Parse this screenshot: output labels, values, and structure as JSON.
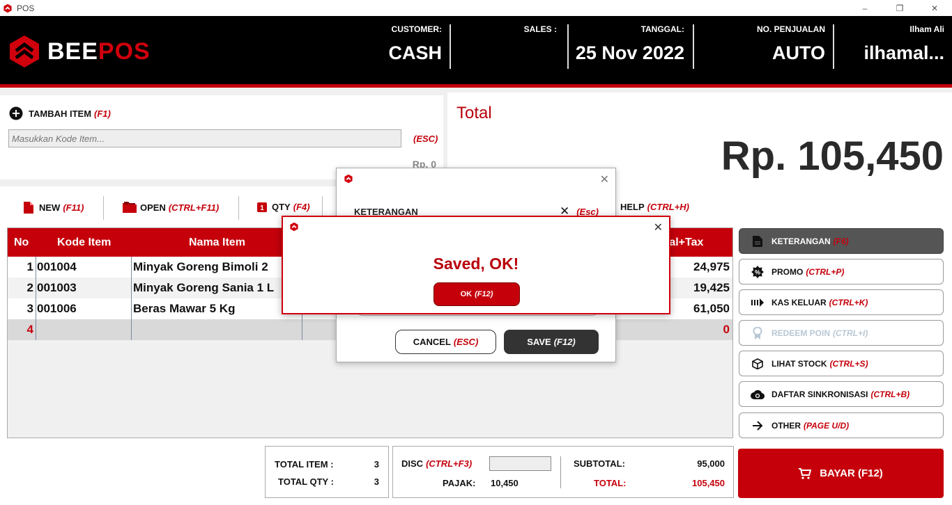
{
  "window": {
    "title": "POS",
    "minimize": "–",
    "restore": "❐",
    "close": "✕"
  },
  "brand": {
    "bee": "BEE",
    "pos": "POS"
  },
  "header": {
    "customer_label": "CUSTOMER:",
    "customer_value": "CASH",
    "sales_label": "SALES :",
    "sales_value": "",
    "date_label": "TANGGAL:",
    "date_value": "25 Nov 2022",
    "sale_no_label": "NO. PENJUALAN",
    "sale_no_value": "AUTO",
    "user_label": "Ilham Ali",
    "user_value": "ilhamal..."
  },
  "add_item": {
    "label": "TAMBAH ITEM",
    "key": "(F1)",
    "placeholder": "Masukkan Kode Item...",
    "esc": "(ESC)",
    "price": "Rp. 0"
  },
  "total": {
    "label": "Total",
    "value": "Rp. 105,450"
  },
  "toolbar": {
    "new_label": "NEW",
    "new_key": "(F11)",
    "open_label": "OPEN",
    "open_key": "(CTRL+F11)",
    "qty_label": "QTY",
    "qty_key": "(F4)",
    "help_label": "HELP",
    "help_key": "(CTRL+H)"
  },
  "grid": {
    "headers": {
      "no": "No",
      "code": "Kode Item",
      "name": "Nama Item",
      "total": "tal+Tax"
    },
    "rows": [
      {
        "no": "1",
        "code": "001004",
        "name": "Minyak Goreng Bimoli 2",
        "total": "24,975"
      },
      {
        "no": "2",
        "code": "001003",
        "name": "Minyak Goreng Sania 1 L",
        "total": "19,425"
      },
      {
        "no": "3",
        "code": "001006",
        "name": "Beras Mawar 5 Kg",
        "total": "61,050"
      },
      {
        "no": "4",
        "code": "",
        "name": "",
        "total": "0"
      }
    ]
  },
  "side": [
    {
      "label": "KETERANGAN",
      "key": "(F6)",
      "icon": "document-icon",
      "state": "active"
    },
    {
      "label": "PROMO",
      "key": "(CTRL+P)",
      "icon": "badge-percent-icon",
      "state": "normal"
    },
    {
      "label": "KAS KELUAR",
      "key": "(CTRL+K)",
      "icon": "cash-out-icon",
      "state": "normal"
    },
    {
      "label": "REDEEM POIN",
      "key": "(CTRL+I)",
      "icon": "award-icon",
      "state": "disabled"
    },
    {
      "label": "LIHAT STOCK",
      "key": "(CTRL+S)",
      "icon": "box-icon",
      "state": "normal"
    },
    {
      "label": "DAFTAR SINKRONISASI",
      "key": "(CTRL+B)",
      "icon": "cloud-sync-icon",
      "state": "normal"
    },
    {
      "label": "OTHER",
      "key": "(PAGE U/D)",
      "icon": "arrow-right-icon",
      "state": "normal"
    }
  ],
  "summary": {
    "total_item_label": "TOTAL ITEM :",
    "total_item_value": "3",
    "total_qty_label": "TOTAL QTY :",
    "total_qty_value": "3",
    "disc_label": "DISC",
    "disc_key": "(CTRL+F3)",
    "disc_value": "",
    "tax_label": "PAJAK:",
    "tax_value": "10,450",
    "subtotal_label": "SUBTOTAL:",
    "subtotal_value": "95,000",
    "grand_label": "TOTAL:",
    "grand_value": "105,450"
  },
  "pay": {
    "label": "BAYAR (F12)"
  },
  "note_dialog": {
    "title_label": "KETERANGAN",
    "esc": "(Esc)",
    "cancel_label": "CANCEL",
    "cancel_key": "(ESC)",
    "save_label": "SAVE",
    "save_key": "(F12)"
  },
  "saved_dialog": {
    "message": "Saved, OK!",
    "ok_label": "OK",
    "ok_key": "(F12)"
  },
  "colors": {
    "brand_red": "#c5000b",
    "header_bg": "#000000",
    "active_btn": "#555555"
  }
}
